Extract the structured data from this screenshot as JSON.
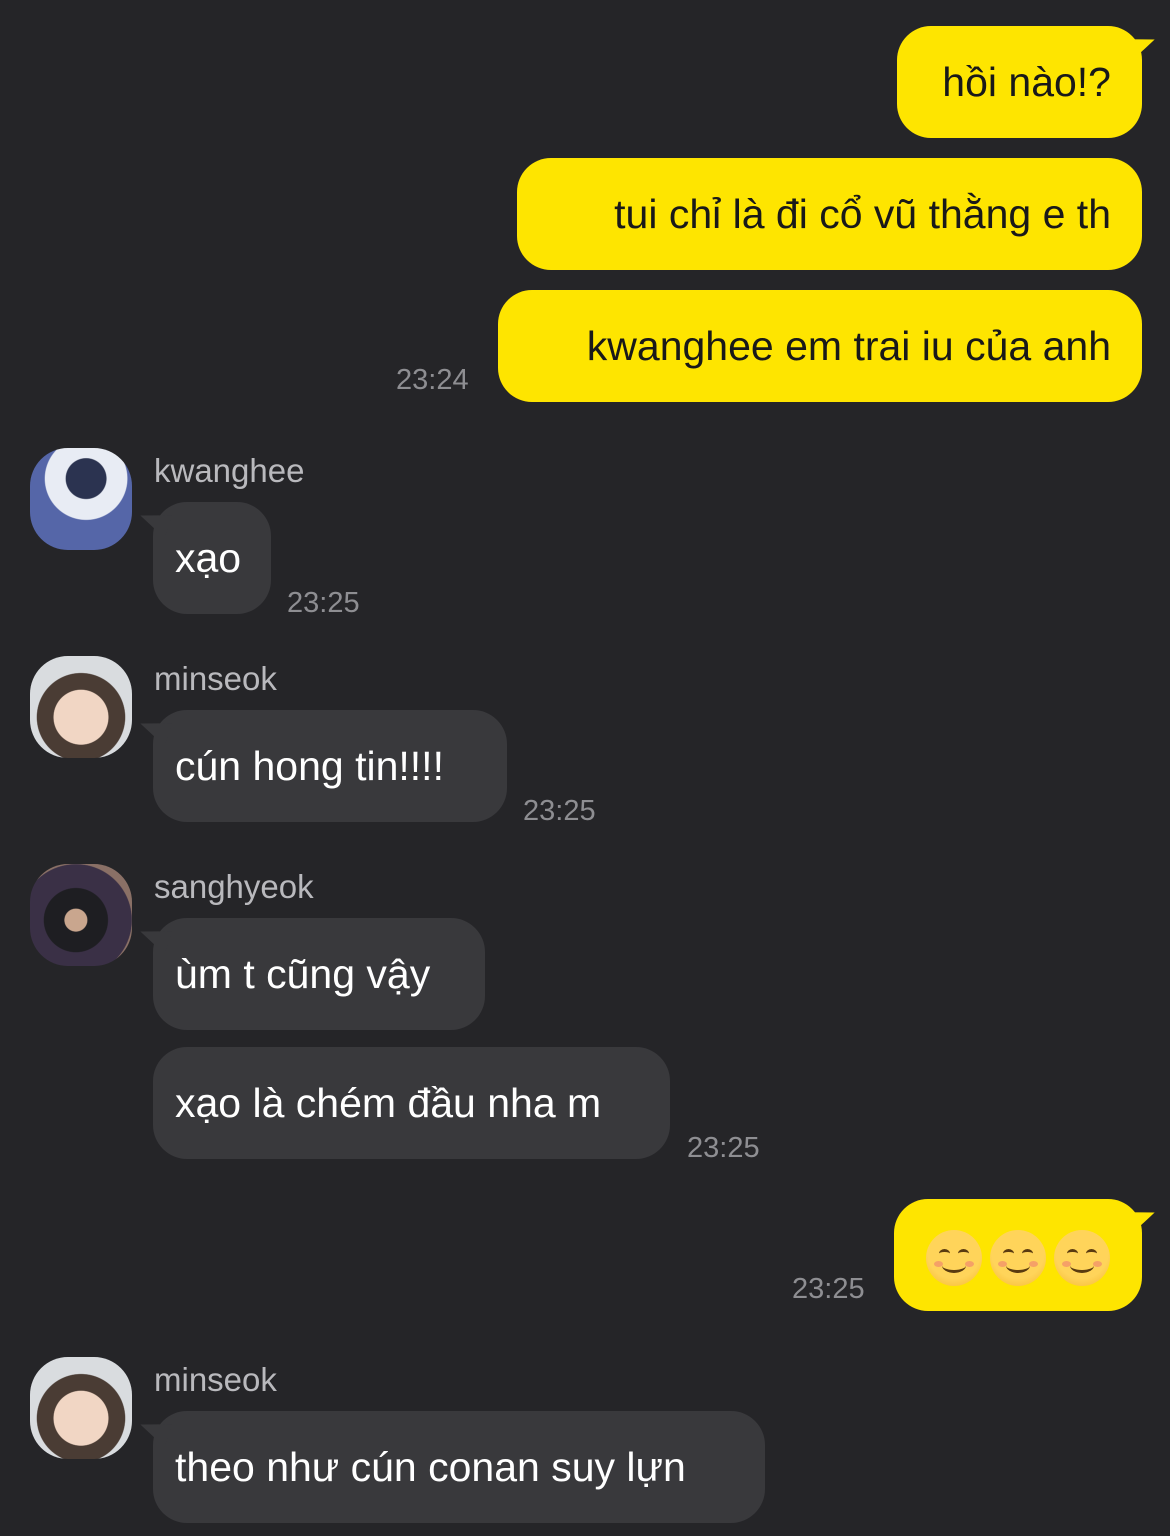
{
  "chat": {
    "outgoing_1": {
      "text": "hồi nào!?"
    },
    "outgoing_2": {
      "text": "tui chỉ là đi cổ vũ thằng e th"
    },
    "outgoing_3": {
      "text": "kwanghee em trai iu của anh",
      "time": "23:24"
    },
    "kwanghee_1": {
      "sender": "kwanghee",
      "text": "xạo",
      "time": "23:25"
    },
    "minseok_1": {
      "sender": "minseok",
      "text": "cún hong tin!!!!",
      "time": "23:25"
    },
    "sanghyeok_1": {
      "sender": "sanghyeok",
      "text": "ùm t cũng vậy"
    },
    "sanghyeok_2": {
      "text": "xạo là chém đầu nha m",
      "time": "23:25"
    },
    "outgoing_4": {
      "emoji": [
        "smiling-face-with-smiling-eyes",
        "smiling-face-with-smiling-eyes",
        "smiling-face-with-smiling-eyes"
      ],
      "time": "23:25"
    },
    "minseok_2": {
      "sender": "minseok",
      "text": "theo như cún conan suy lựn"
    }
  },
  "colors": {
    "background": "#252528",
    "outgoing_bubble": "#fee500",
    "incoming_bubble": "#39393c",
    "timestamp": "#8e8e92",
    "sender_name": "#b9b9bd"
  }
}
